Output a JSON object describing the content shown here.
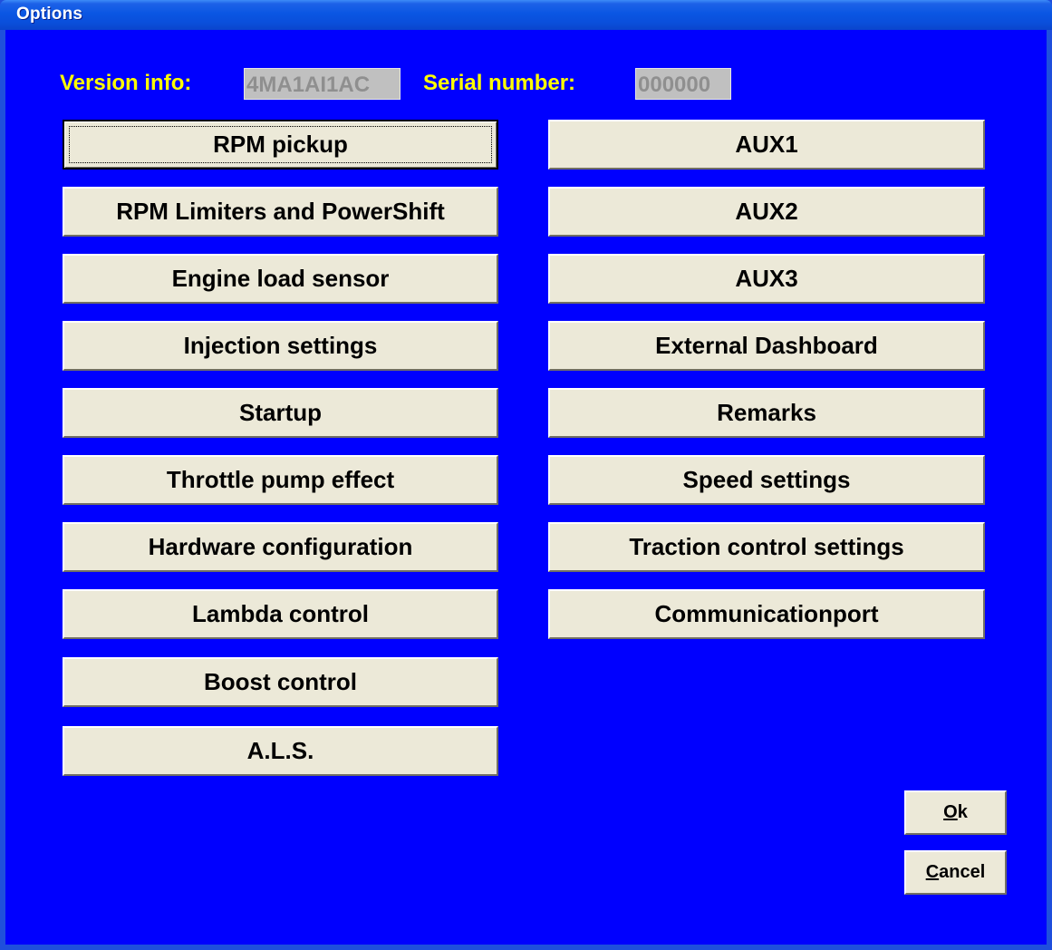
{
  "window": {
    "title": "Options"
  },
  "info": {
    "version_label": "Version info:",
    "version_value": "4MA1AI1AC",
    "serial_label": "Serial number:",
    "serial_value": "000000"
  },
  "left_buttons": [
    "RPM pickup",
    "RPM Limiters and PowerShift",
    "Engine load sensor",
    "Injection settings",
    "Startup",
    "Throttle pump effect",
    "Hardware configuration",
    "Lambda control",
    "Boost control",
    "A.L.S."
  ],
  "right_buttons": [
    "AUX1",
    "AUX2",
    "AUX3",
    "External Dashboard",
    "Remarks",
    "Speed settings",
    "Traction control settings",
    "Communicationport"
  ],
  "dialog_buttons": {
    "ok_accel": "O",
    "ok_rest": "k",
    "cancel_accel": "C",
    "cancel_rest": "ancel"
  }
}
